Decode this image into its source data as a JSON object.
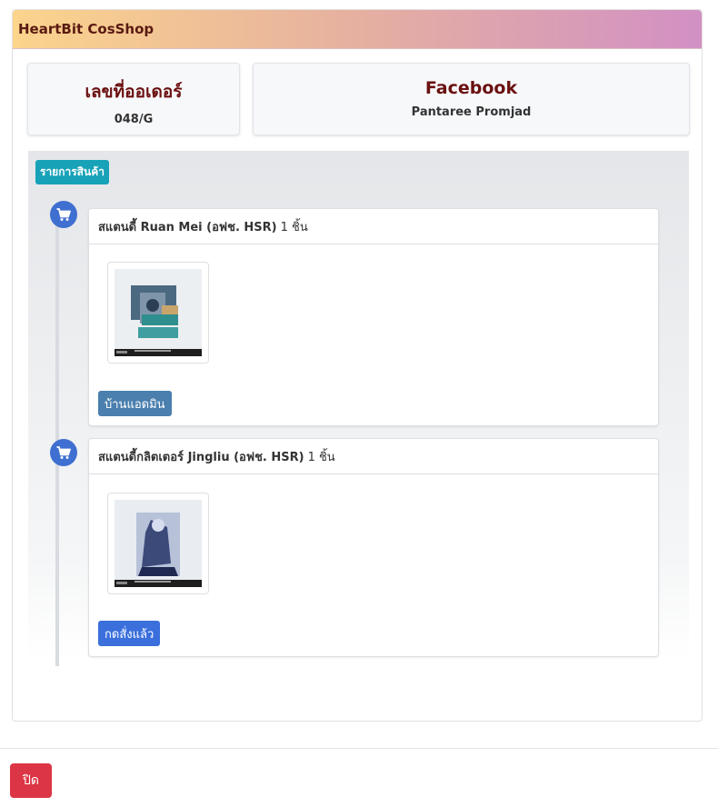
{
  "shop_title": "HeartBit CosShop",
  "order": {
    "label": "เลขที่ออเดอร์",
    "number": "048/G"
  },
  "contact": {
    "label": "Facebook",
    "name": "Pantaree Promjad"
  },
  "items_label": "รายการสินค้า",
  "items": [
    {
      "name": "สแตนดี้ Ruan Mei (อฟช. HSR)",
      "qty": "1 ชิ้น",
      "status": "บ้านแอดมิน",
      "status_color": "#4a7fae"
    },
    {
      "name": "สแตนดี้กลิตเตอร์ Jingliu (อฟช. HSR)",
      "qty": "1 ชิ้น",
      "status": "กดสั่งแล้ว",
      "status_color": "#3a6fdc"
    }
  ],
  "close_label": "ปิด",
  "icons": {
    "cart": "cart-icon",
    "product": "product-image"
  }
}
